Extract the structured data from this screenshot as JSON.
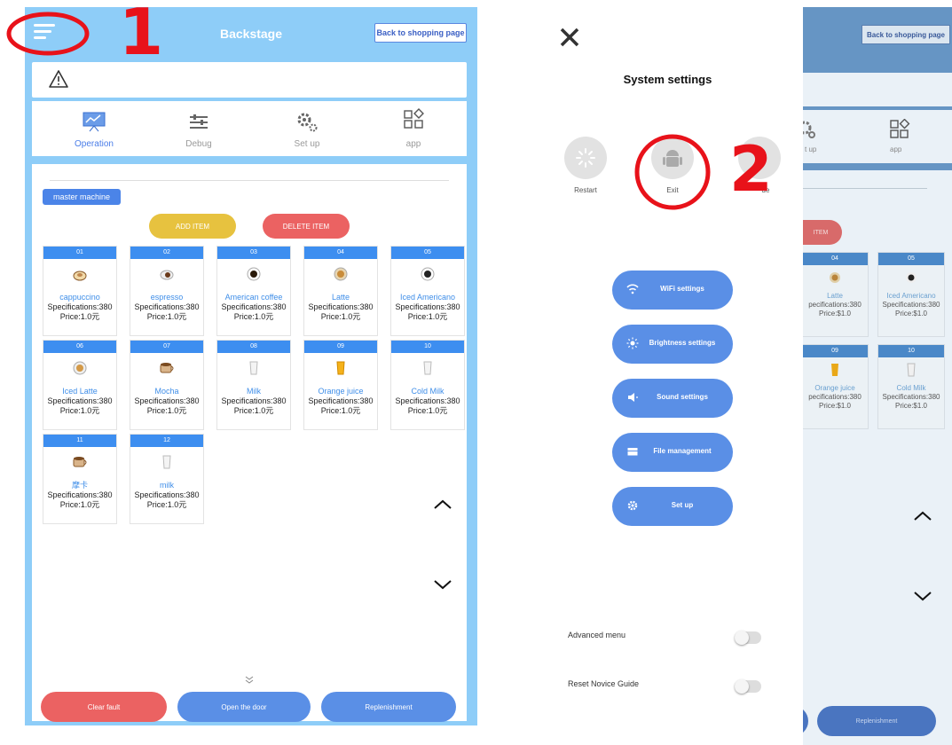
{
  "header": {
    "title": "Backstage",
    "back_label": "Back to shopping page"
  },
  "tabs": [
    {
      "label": "Operation",
      "icon": "monitor-icon",
      "active": true
    },
    {
      "label": "Debug",
      "icon": "sliders-icon"
    },
    {
      "label": "Set up",
      "icon": "gears-icon"
    },
    {
      "label": "app",
      "icon": "apps-icon"
    }
  ],
  "main": {
    "master_label": "master machine",
    "add_label": "ADD ITEM",
    "delete_label": "DELETE ITEM",
    "items": [
      {
        "num": "01",
        "name": "cappuccino",
        "spec": "Specifications:380",
        "price": "Price:1.0元"
      },
      {
        "num": "02",
        "name": "espresso",
        "spec": "Specifications:380",
        "price": "Price:1.0元"
      },
      {
        "num": "03",
        "name": "American coffee",
        "spec": "Specifications:380",
        "price": "Price:1.0元"
      },
      {
        "num": "04",
        "name": "Latte",
        "spec": "Specifications:380",
        "price": "Price:1.0元"
      },
      {
        "num": "05",
        "name": "Iced Americano",
        "spec": "Specifications:380",
        "price": "Price:1.0元"
      },
      {
        "num": "06",
        "name": "Iced Latte",
        "spec": "Specifications:380",
        "price": "Price:1.0元"
      },
      {
        "num": "07",
        "name": "Mocha",
        "spec": "Specifications:380",
        "price": "Price:1.0元"
      },
      {
        "num": "08",
        "name": "Milk",
        "spec": "Specifications:380",
        "price": "Price:1.0元"
      },
      {
        "num": "09",
        "name": "Orange juice",
        "spec": "Specifications:380",
        "price": "Price:1.0元"
      },
      {
        "num": "10",
        "name": "Cold Milk",
        "spec": "Specifications:380",
        "price": "Price:1.0元"
      },
      {
        "num": "11",
        "name": "摩卡",
        "spec": "Specifications:380",
        "price": "Price:1.0元"
      },
      {
        "num": "12",
        "name": "milk",
        "spec": "Specifications:380",
        "price": "Price:1.0元"
      }
    ]
  },
  "bottom": {
    "clear_label": "Clear fault",
    "open_label": "Open the door",
    "replenish_label": "Replenishment"
  },
  "settings": {
    "title": "System settings",
    "restart_label": "Restart",
    "exit_label": "Exit",
    "third_label_partial": "de",
    "menu": [
      {
        "label": "WiFi settings",
        "icon": "wifi-icon"
      },
      {
        "label": "Brightness settings",
        "icon": "brightness-icon"
      },
      {
        "label": "Sound settings",
        "icon": "speaker-icon"
      },
      {
        "label": "File management",
        "icon": "folder-icon"
      },
      {
        "label": "Set up",
        "icon": "gear-icon"
      }
    ],
    "advanced_label": "Advanced menu",
    "reset_label": "Reset Novice Guide"
  },
  "right": {
    "back_label": "Back to shopping page",
    "tab_partial_setup": "t up",
    "tab_app": "app",
    "del_partial": "ITEM",
    "items": [
      {
        "num": "04",
        "name": "Latte",
        "spec": "pecifications:380",
        "price": "Price:$1.0"
      },
      {
        "num": "05",
        "name": "Iced Americano",
        "spec": "Specifications:380",
        "price": "Price:$1.0"
      },
      {
        "num": "09",
        "name": "Orange juice",
        "spec": "pecifications:380",
        "price": "Price:$1.0"
      },
      {
        "num": "10",
        "name": "Cold Milk",
        "spec": "Specifications:380",
        "price": "Price:$1.0"
      }
    ],
    "replenish_label": "Replenishment"
  },
  "annotations": {
    "one": "1",
    "two": "2"
  },
  "colors": {
    "accent": "#4a7de8",
    "bg_blue": "#8ecdf8",
    "red": "#eb6262",
    "yellow": "#e7c23f",
    "annotation_red": "#e8121a"
  }
}
